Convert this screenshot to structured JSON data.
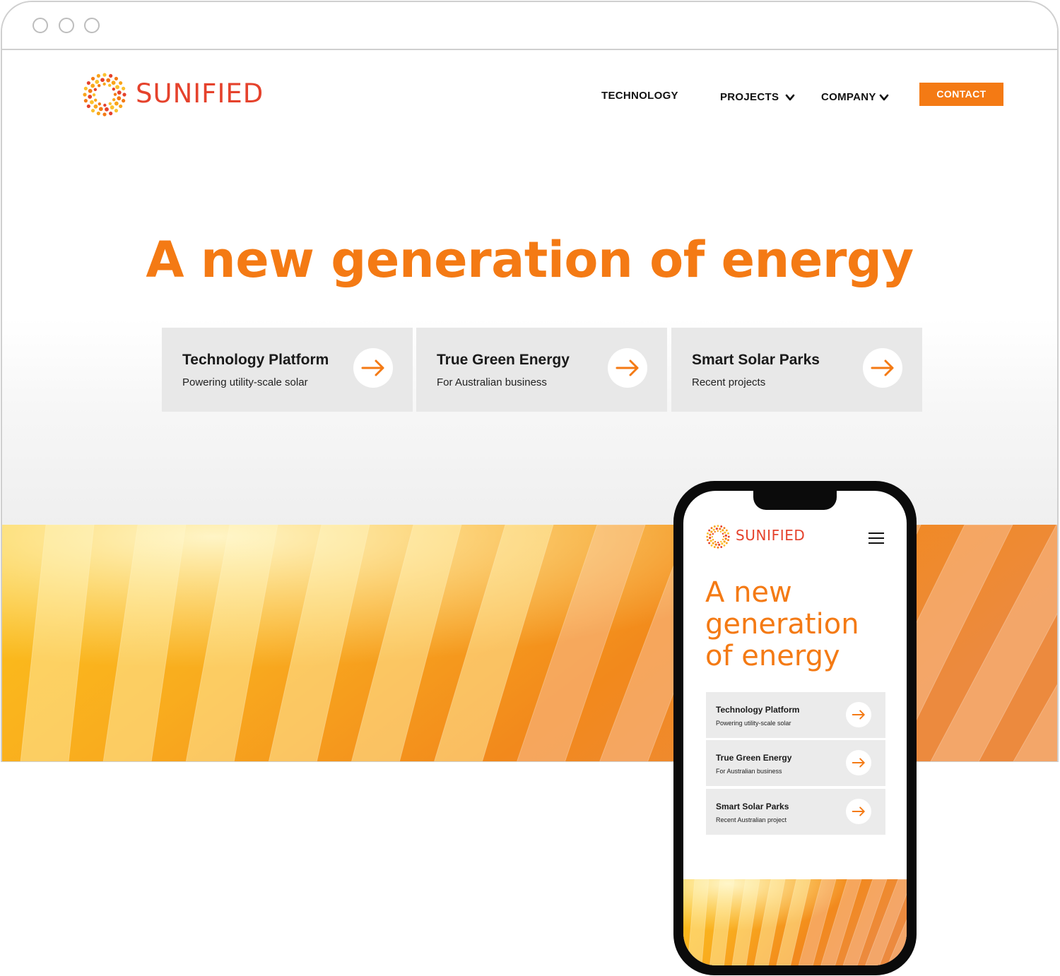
{
  "brand": {
    "name": "SUNIFIED",
    "primary_color": "#f47a14",
    "logo_color": "#e5422c"
  },
  "desktop": {
    "nav": {
      "technology": "TECHNOLOGY",
      "projects": "PROJECTS",
      "company": "COMPANY",
      "contact": "CONTACT"
    },
    "hero_title": "A new generation of energy",
    "cards": [
      {
        "title": "Technology Platform",
        "subtitle": "Powering utility-scale solar",
        "icon": "arrow-right-icon"
      },
      {
        "title": "True Green Energy",
        "subtitle": "For Australian business",
        "icon": "arrow-right-icon"
      },
      {
        "title": "Smart Solar Parks",
        "subtitle": "Recent projects",
        "icon": "arrow-right-icon"
      }
    ]
  },
  "mobile": {
    "hero_title": "A new generation of energy",
    "menu_icon": "hamburger-icon",
    "cards": [
      {
        "title": "Technology Platform",
        "subtitle": "Powering utility-scale solar"
      },
      {
        "title": "True Green Energy",
        "subtitle": "For Australian business"
      },
      {
        "title": "Smart Solar Parks",
        "subtitle": "Recent Australian project"
      }
    ]
  }
}
